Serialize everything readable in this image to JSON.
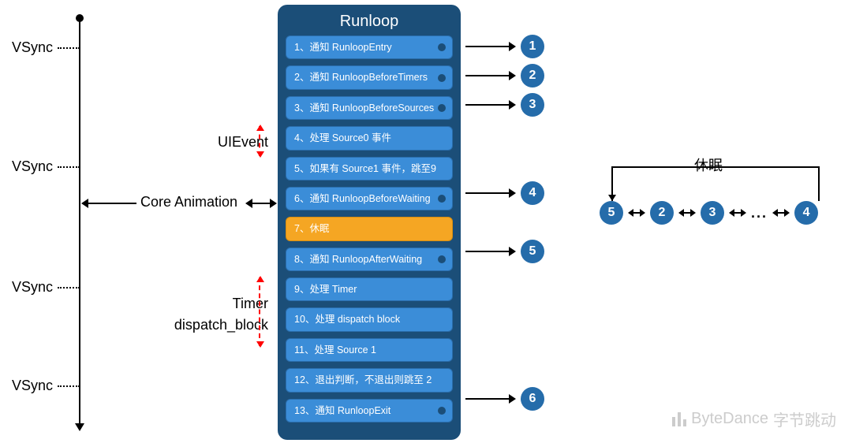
{
  "timeline": {
    "vsync_label": "VSync",
    "vsync_positions": [
      50,
      201,
      354,
      479
    ]
  },
  "side_labels": {
    "uievent": "UIEvent",
    "core_animation": "Core Animation",
    "timer_line1": "Timer",
    "timer_line2": "dispatch_block"
  },
  "runloop": {
    "title": "Runloop",
    "steps": [
      {
        "label": "1、通知 RunloopEntry",
        "observable": true,
        "out": 1
      },
      {
        "label": "2、通知 RunloopBeforeTimers",
        "observable": true,
        "out": 2
      },
      {
        "label": "3、通知 RunloopBeforeSources",
        "observable": true,
        "out": 3
      },
      {
        "label": "4、处理 Source0 事件",
        "observable": false
      },
      {
        "label": "5、如果有 Source1 事件，跳至9",
        "observable": false
      },
      {
        "label": "6、通知 RunloopBeforeWaiting",
        "observable": true,
        "out": 4
      },
      {
        "label": "7、休眠",
        "observable": false,
        "sleep": true
      },
      {
        "label": "8、通知 RunloopAfterWaiting",
        "observable": true,
        "out": 5
      },
      {
        "label": "9、处理 Timer",
        "observable": false
      },
      {
        "label": "10、处理 dispatch block",
        "observable": false
      },
      {
        "label": "11、处理 Source 1",
        "observable": false
      },
      {
        "label": "12、退出判断，不退出则跳至 2",
        "observable": false
      },
      {
        "label": "13、通知 RunloopExit",
        "observable": true,
        "out": 6
      }
    ]
  },
  "sequence": {
    "sleep_label": "休眠",
    "nodes": [
      "5",
      "2",
      "3",
      "...",
      "4"
    ]
  },
  "watermark": {
    "brand_en": "ByteDance",
    "brand_cn": "字节跳动"
  }
}
